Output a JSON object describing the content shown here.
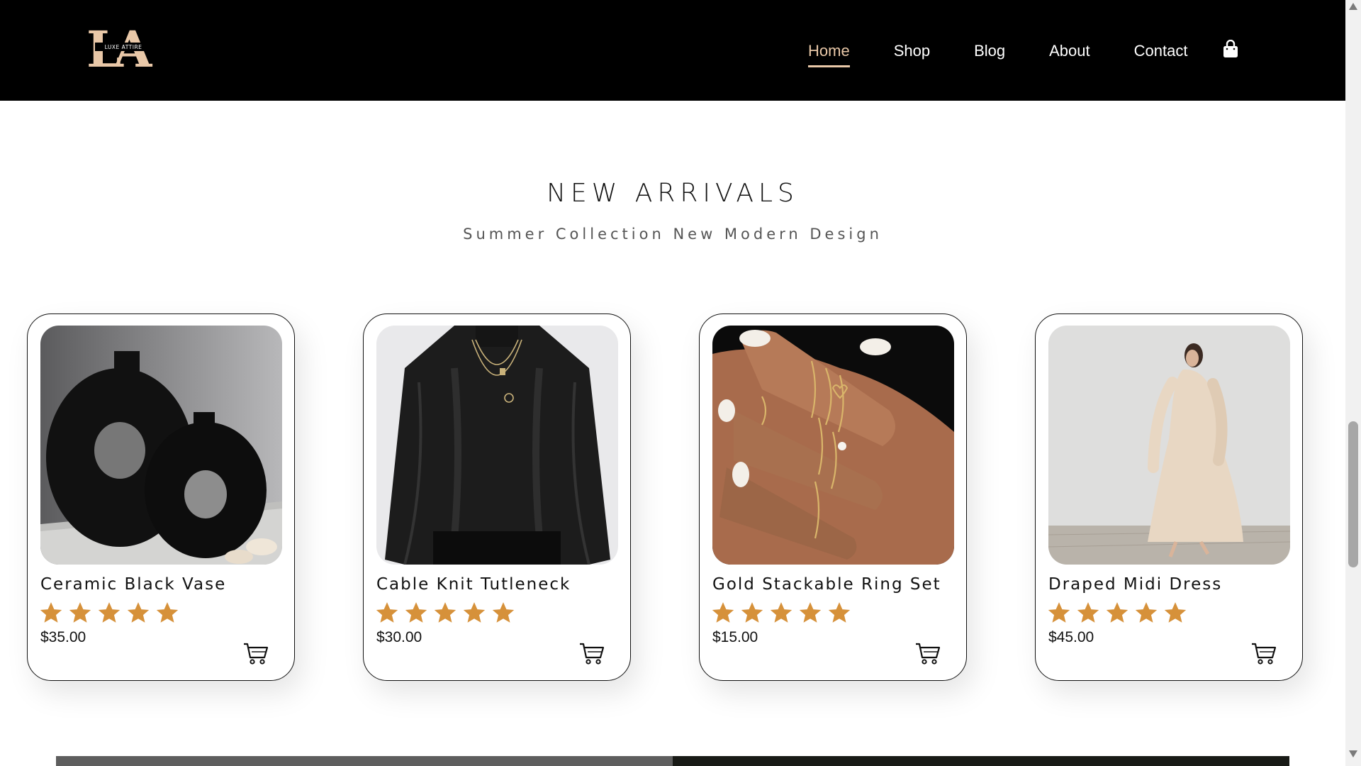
{
  "header": {
    "logo": {
      "monogram": "LA",
      "text": "LUXE ATTIRE"
    },
    "nav": [
      {
        "label": "Home",
        "active": true
      },
      {
        "label": "Shop",
        "active": false
      },
      {
        "label": "Blog",
        "active": false
      },
      {
        "label": "About",
        "active": false
      },
      {
        "label": "Contact",
        "active": false
      }
    ],
    "cart_icon": "shopping-bag-icon"
  },
  "section": {
    "title": "NEW ARRIVALS",
    "subtitle": "Summer Collection New Modern Design"
  },
  "products": [
    {
      "name": "Ceramic Black Vase",
      "price": "$35.00",
      "rating": 5,
      "image_icon": "vase-photo"
    },
    {
      "name": "Cable Knit Tutleneck",
      "price": "$30.00",
      "rating": 5,
      "image_icon": "sweater-photo"
    },
    {
      "name": "Gold Stackable Ring Set",
      "price": "$15.00",
      "rating": 5,
      "image_icon": "rings-photo"
    },
    {
      "name": "Draped Midi Dress",
      "price": "$45.00",
      "rating": 5,
      "image_icon": "dress-photo"
    }
  ],
  "colors": {
    "accent": "#e9c8a8",
    "star": "#d6913a",
    "header_bg": "#000000"
  }
}
